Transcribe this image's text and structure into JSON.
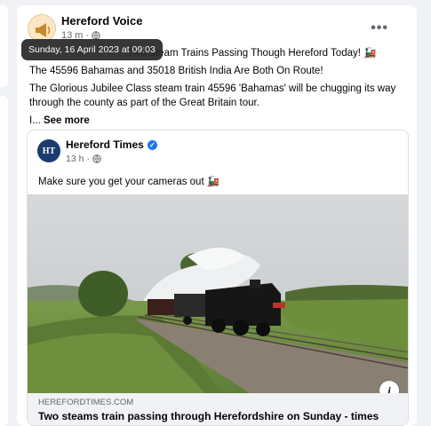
{
  "post": {
    "page_name": "Hereford Voice",
    "time": "13 m",
    "separator": "·",
    "more_label": "•••",
    "tooltip": "Sunday, 16 April 2023 at 09:03",
    "headline": "Two Steam Trains Passing Though Hereford Today! 🚂",
    "line2": "The 45596 Bahamas and 35018 British India Are Both On Route!",
    "line3": "The Glorious Jubilee Class steam train 45596 'Bahamas' will be chugging its way through the county as part of the Great Britain tour.",
    "ellipsis": "I... ",
    "see_more": "See more"
  },
  "shared": {
    "logo_text": "HT",
    "page_name": "Hereford Times",
    "time": "13 h",
    "separator": "·",
    "text": "Make sure you get your cameras out 🚂",
    "info_label": "i",
    "link_domain": "HEREFORDTIMES.COM",
    "link_title": "Two steams train passing through Herefordshire on Sunday - times"
  },
  "colors": {
    "verified": "#1877f2",
    "logo_bg": "#1b3c70"
  }
}
